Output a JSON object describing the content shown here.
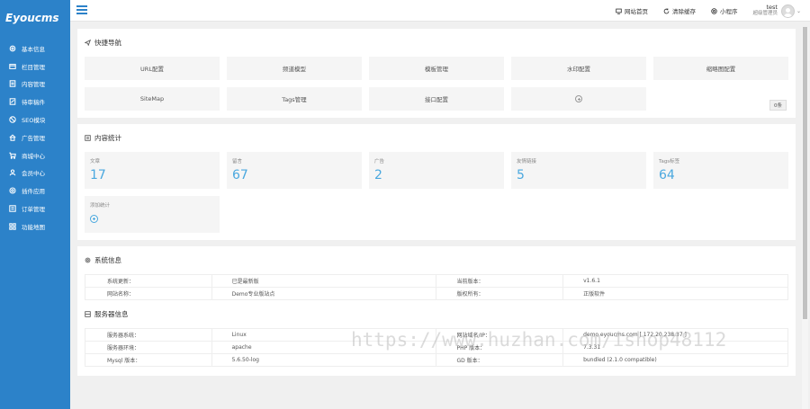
{
  "sidebar": {
    "logo": "Eyoucms",
    "items": [
      {
        "label": "基本信息",
        "icon": "gear-icon"
      },
      {
        "label": "栏目管理",
        "icon": "folders-icon"
      },
      {
        "label": "内容管理",
        "icon": "document-icon"
      },
      {
        "label": "待审稿件",
        "icon": "edit-icon"
      },
      {
        "label": "SEO模块",
        "icon": "seo-icon"
      },
      {
        "label": "广告管理",
        "icon": "home-icon"
      },
      {
        "label": "商城中心",
        "icon": "cart-icon"
      },
      {
        "label": "会员中心",
        "icon": "user-icon"
      },
      {
        "label": "插件应用",
        "icon": "plugin-icon"
      },
      {
        "label": "订单管理",
        "icon": "list-icon"
      },
      {
        "label": "功能地图",
        "icon": "grid-icon"
      }
    ]
  },
  "topbar": {
    "site_home": "网站首页",
    "clear_cache": "清除缓存",
    "mini_program": "小程序",
    "username": "test",
    "role": "超级管理员"
  },
  "quick_nav": {
    "title": "快捷导航",
    "items": [
      "URL配置",
      "频道模型",
      "模板管理",
      "水印配置",
      "缩略图配置",
      "SiteMap",
      "Tags管理",
      "接口配置"
    ],
    "badge": "0条"
  },
  "content_stats": {
    "title": "内容统计",
    "items": [
      {
        "label": "文章",
        "value": "17"
      },
      {
        "label": "留言",
        "value": "67"
      },
      {
        "label": "广告",
        "value": "2"
      },
      {
        "label": "友情链接",
        "value": "5"
      },
      {
        "label": "Tags标签",
        "value": "64"
      }
    ],
    "add_label": "添加统计"
  },
  "system_info": {
    "title": "系统信息",
    "rows": [
      [
        "系统更新：",
        "已是最新版",
        "当前版本：",
        "v1.6.1"
      ],
      [
        "网站名称：",
        "Demo专业版站点",
        "版权所有：",
        "正版软件"
      ]
    ]
  },
  "server_info": {
    "title": "服务器信息",
    "rows": [
      [
        "服务器系统：",
        "Linux",
        "网站域名/IP：",
        "demo.eyoucms.com [ 172.20.238.37 ]"
      ],
      [
        "服务器环境：",
        "apache",
        "PHP 版本：",
        "7.3.31"
      ],
      [
        "Mysql 版本：",
        "5.6.50-log",
        "GD 版本：",
        "bundled (2.1.0 compatible)"
      ]
    ]
  },
  "watermark": "https://www.huzhan.com/ishop48112"
}
